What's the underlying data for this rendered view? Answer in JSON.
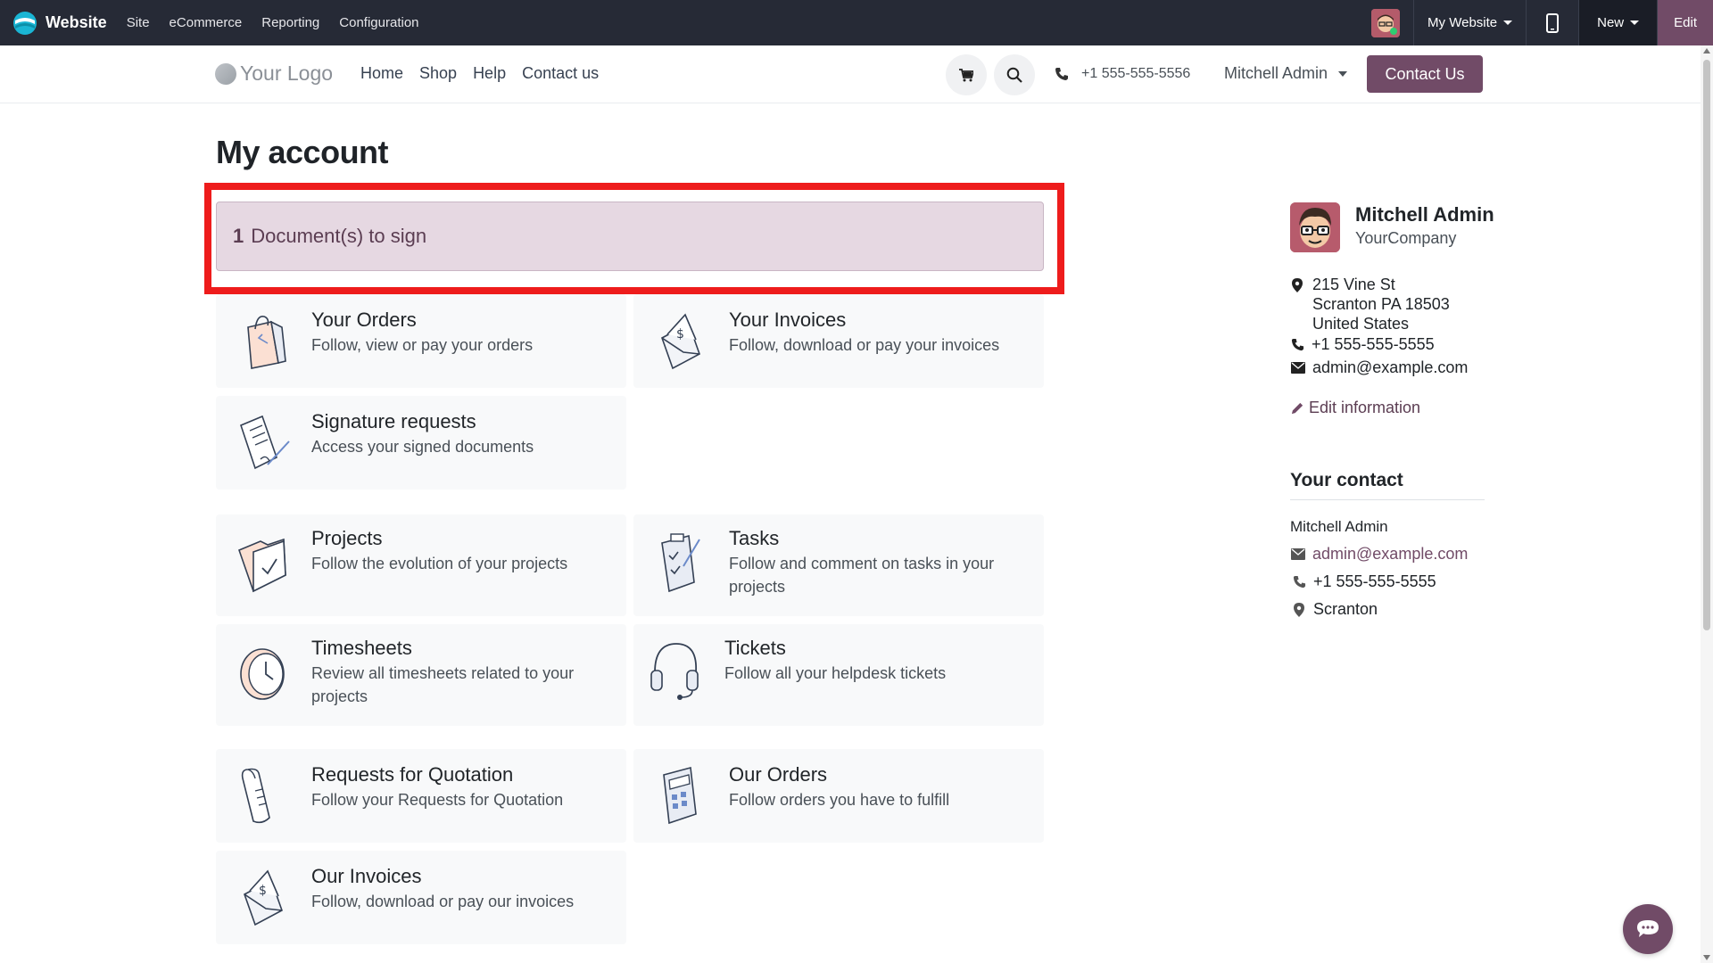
{
  "admin_bar": {
    "app_name": "Website",
    "menu": [
      "Site",
      "eCommerce",
      "Reporting",
      "Configuration"
    ],
    "website_switcher": "My Website",
    "new_label": "New",
    "edit_label": "Edit"
  },
  "header": {
    "brand": "Your Logo",
    "nav": [
      "Home",
      "Shop",
      "Help",
      "Contact us"
    ],
    "phone": "+1 555-555-5556",
    "user": "Mitchell Admin",
    "contact_button": "Contact Us"
  },
  "main": {
    "title": "My account",
    "alert": {
      "count": "1",
      "text": "Document(s) to sign"
    },
    "cards": [
      {
        "title": "Your Orders",
        "desc": "Follow, view or pay your orders",
        "icon": "shopping-bag-icon"
      },
      {
        "title": "Your Invoices",
        "desc": "Follow, download or pay your invoices",
        "icon": "invoice-envelope-icon"
      },
      {
        "title": "Signature requests",
        "desc": "Access your signed documents",
        "icon": "signature-document-icon"
      },
      {
        "title": "Projects",
        "desc": "Follow the evolution of your projects",
        "icon": "folder-check-icon"
      },
      {
        "title": "Tasks",
        "desc": "Follow and comment on tasks in your projects",
        "icon": "task-checklist-icon"
      },
      {
        "title": "Timesheets",
        "desc": "Review all timesheets related to your projects",
        "icon": "clock-icon"
      },
      {
        "title": "Tickets",
        "desc": "Follow all your helpdesk tickets",
        "icon": "headset-icon"
      },
      {
        "title": "Requests for Quotation",
        "desc": "Follow your Requests for Quotation",
        "icon": "scroll-document-icon"
      },
      {
        "title": "Our Orders",
        "desc": "Follow orders you have to fulfill",
        "icon": "calculator-icon"
      },
      {
        "title": "Our Invoices",
        "desc": "Follow, download or pay our invoices",
        "icon": "invoice-envelope-icon"
      }
    ]
  },
  "sidebar": {
    "name": "Mitchell Admin",
    "company": "YourCompany",
    "address": [
      "215 Vine St",
      "Scranton PA 18503",
      "United States"
    ],
    "phone": "+1 555-555-5555",
    "email": "admin@example.com",
    "edit_info": "Edit information",
    "your_contact": {
      "heading": "Your contact",
      "name": "Mitchell Admin",
      "email": "admin@example.com",
      "phone": "+1 555-555-5555",
      "city": "Scranton"
    }
  },
  "colors": {
    "admin_bar": "#262a36",
    "brand_primary": "#714b67",
    "alert_bg": "#e6d8e2",
    "highlight": "#ee1c1c"
  }
}
